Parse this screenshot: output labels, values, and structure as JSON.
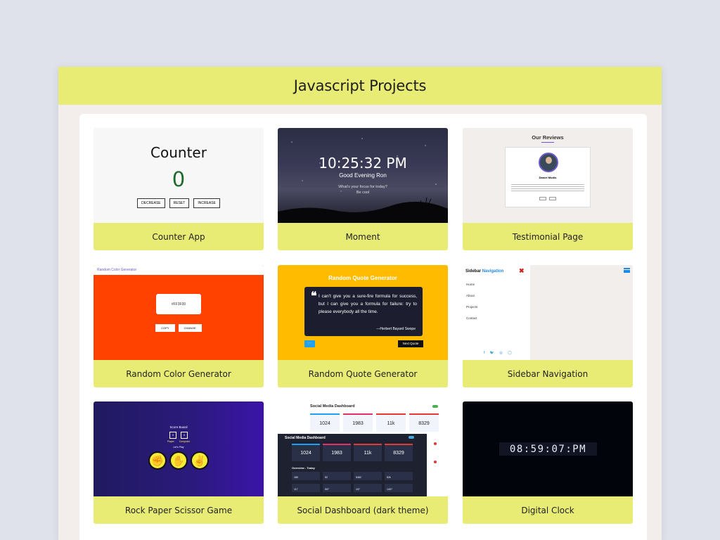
{
  "page": {
    "title": "Javascript Projects"
  },
  "projects": [
    {
      "caption": "Counter App"
    },
    {
      "caption": "Moment"
    },
    {
      "caption": "Testimonial Page"
    },
    {
      "caption": "Random Color Generator"
    },
    {
      "caption": "Random Quote Generator"
    },
    {
      "caption": "Sidebar Navigation"
    },
    {
      "caption": "Rock Paper Scissor Game"
    },
    {
      "caption": "Social Dashboard (dark theme)"
    },
    {
      "caption": "Digital Clock"
    }
  ],
  "counter": {
    "title": "Counter",
    "value": "0",
    "buttons": [
      "DECREASE",
      "RESET",
      "INCREASE"
    ]
  },
  "moment": {
    "time": "10:25:32 PM",
    "greeting": "Good Evening Ron",
    "question1": "What's your focus for today?",
    "question2": "Be cool"
  },
  "testimonial": {
    "heading": "Our Reviews",
    "name": "Daniel Modis"
  },
  "random_color": {
    "bar_label": "Random Color Generator",
    "hex": "#FF3F00",
    "buttons": [
      "COPY",
      "CHANGE"
    ]
  },
  "quote": {
    "title": "Random Quote Generator",
    "text": "I can't give you a sure-fire formula for success, but I can give you a formula for failure: try to please everybody all the time.",
    "author": "—Herbert Bayard Swope",
    "next": "Next Quote",
    "colors": {
      "bg": "#ffbb00",
      "box": "#1d1d30"
    }
  },
  "sidebar": {
    "title_a": "Sidebar ",
    "title_b": "Navigation",
    "close": "✖",
    "links": [
      "Home",
      "About",
      "Projects",
      "Contact"
    ],
    "social": "f 🐦 ◎ ◯"
  },
  "rps": {
    "title": "Score Board",
    "scores": [
      "0",
      "0"
    ],
    "labels": "Player Computer",
    "sub": "Let's Play",
    "hands": [
      "✊",
      "✋",
      "✌"
    ]
  },
  "dashboard": {
    "title": "Social Media Dashboard",
    "light_values": [
      "1024",
      "1983",
      "11k",
      "8329"
    ],
    "dark_values": [
      "1024",
      "1983",
      "11k",
      "8329"
    ],
    "overview": "Overview - Today",
    "small_values": [
      "180",
      "52",
      "5462",
      "52k",
      "117",
      "507",
      "107",
      "1407"
    ]
  },
  "clock": {
    "time": "08:59:07:PM"
  },
  "colors": {
    "accent": "#e9ec74",
    "page_bg": "#dfe2eb"
  }
}
